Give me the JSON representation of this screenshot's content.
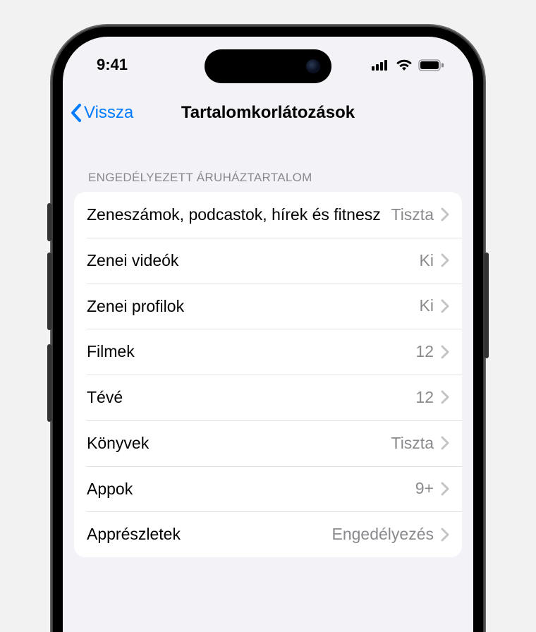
{
  "status": {
    "time": "9:41"
  },
  "nav": {
    "back_label": "Vissza",
    "title": "Tartalomkorlátozások"
  },
  "section": {
    "header": "ENGEDÉLYEZETT ÁRUHÁZTARTALOM"
  },
  "rows": [
    {
      "label": "Zeneszámok, podcastok, hírek és fitnesz",
      "value": "Tiszta"
    },
    {
      "label": "Zenei videók",
      "value": "Ki"
    },
    {
      "label": "Zenei profilok",
      "value": "Ki"
    },
    {
      "label": "Filmek",
      "value": "12"
    },
    {
      "label": "Tévé",
      "value": "12"
    },
    {
      "label": "Könyvek",
      "value": "Tiszta"
    },
    {
      "label": "Appok",
      "value": "9+"
    },
    {
      "label": "Apprészletek",
      "value": "Engedélyezés"
    }
  ]
}
